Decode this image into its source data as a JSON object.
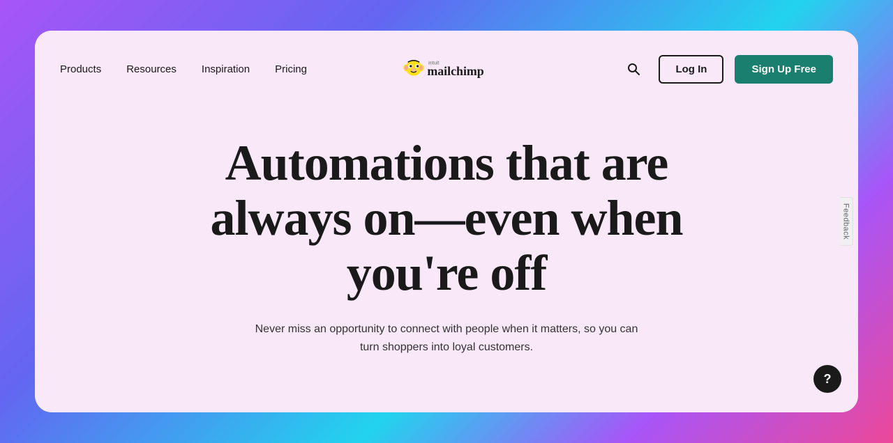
{
  "page": {
    "background": "gradient purple-cyan-pink"
  },
  "navbar": {
    "logo_alt": "Intuit Mailchimp",
    "nav_items": [
      {
        "label": "Products",
        "id": "products"
      },
      {
        "label": "Resources",
        "id": "resources"
      },
      {
        "label": "Inspiration",
        "id": "inspiration"
      },
      {
        "label": "Pricing",
        "id": "pricing"
      }
    ],
    "search_label": "Search",
    "login_label": "Log In",
    "signup_label": "Sign Up Free"
  },
  "hero": {
    "title": "Automations that are always on—even when you're off",
    "subtitle": "Never miss an opportunity to connect with people when it matters, so you can turn shoppers into loyal customers."
  },
  "sidebar": {
    "feedback_label": "Feedback"
  },
  "help": {
    "label": "?"
  }
}
